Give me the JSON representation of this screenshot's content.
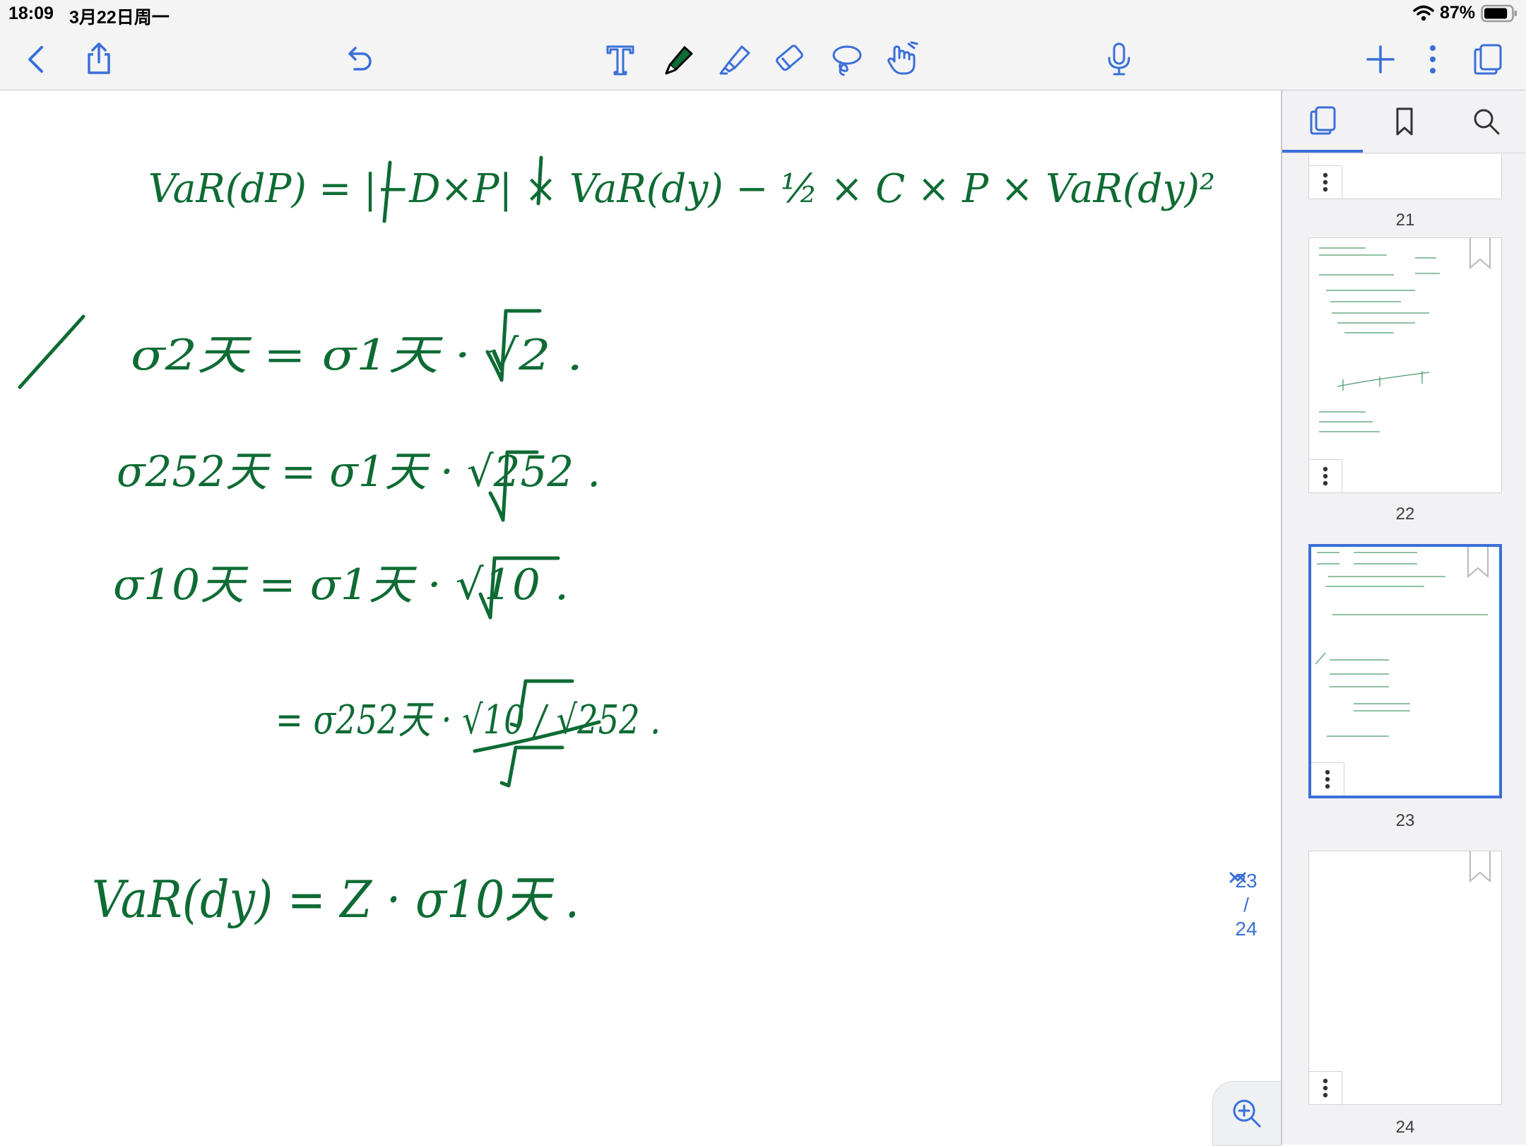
{
  "status_bar": {
    "time": "18:09",
    "date": "3月22日周一",
    "battery_text": "87%",
    "battery_level": 0.87
  },
  "toolbar": {
    "icons": [
      "back-icon",
      "share-icon",
      "undo-icon",
      "text-tool-icon",
      "pen-tool-icon",
      "highlighter-icon",
      "eraser-icon",
      "lasso-icon",
      "hand-tool-icon",
      "microphone-icon",
      "add-page-icon",
      "more-icon",
      "pages-view-icon"
    ],
    "active_tool": "pen-tool-icon",
    "ink_color": "#0e6b34"
  },
  "note": {
    "ink_color": "#0e6b34",
    "lines": [
      "VaR(dP) = |−D×P| × VaR(dy) − ½ × C × P × VaR(dy)²",
      "σ2天 = σ1天 · √2 .",
      "σ252天 = σ1天 · √252 .",
      "σ10天 = σ1天 · √10 .",
      "= σ252天 · √10 / √252 .",
      "VaR(dy) = Z · σ10天 ."
    ]
  },
  "page_navigator": {
    "current": "23",
    "separator": "/",
    "total": "24"
  },
  "sidebar": {
    "tabs": [
      "pages-tab-icon",
      "bookmarks-tab-icon",
      "search-tab-icon"
    ],
    "active_tab": "pages-tab-icon",
    "accent_color": "#3a6fd8",
    "thumbnails": [
      {
        "page": "21",
        "selected": false
      },
      {
        "page": "22",
        "selected": false
      },
      {
        "page": "23",
        "selected": true
      },
      {
        "page": "24",
        "selected": false
      }
    ]
  }
}
